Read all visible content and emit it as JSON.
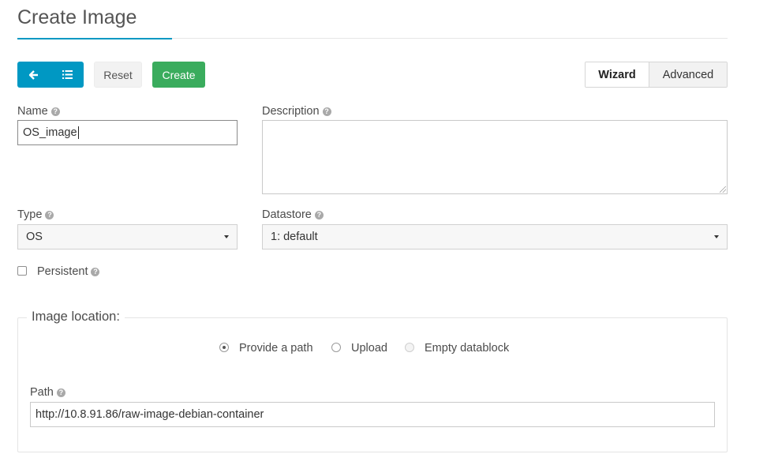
{
  "page": {
    "title": "Create Image"
  },
  "toolbar": {
    "back_icon": "arrow-left-icon",
    "list_icon": "list-icon",
    "reset_label": "Reset",
    "create_label": "Create",
    "wizard_label": "Wizard",
    "advanced_label": "Advanced",
    "mode_selected": "Wizard"
  },
  "form": {
    "name": {
      "label": "Name",
      "value": "OS_image"
    },
    "description": {
      "label": "Description",
      "value": ""
    },
    "type": {
      "label": "Type",
      "value": "OS"
    },
    "datastore": {
      "label": "Datastore",
      "value": "1: default"
    },
    "persistent": {
      "label": "Persistent",
      "checked": false
    }
  },
  "image_location": {
    "legend": "Image location:",
    "options": [
      {
        "label": "Provide a path",
        "selected": true,
        "disabled": false
      },
      {
        "label": "Upload",
        "selected": false,
        "disabled": false
      },
      {
        "label": "Empty datablock",
        "selected": false,
        "disabled": true
      }
    ],
    "path": {
      "label": "Path",
      "value": "http://10.8.91.86/raw-image-debian-container"
    }
  },
  "colors": {
    "accent": "#0098c3",
    "create_green": "#3aac5d"
  }
}
